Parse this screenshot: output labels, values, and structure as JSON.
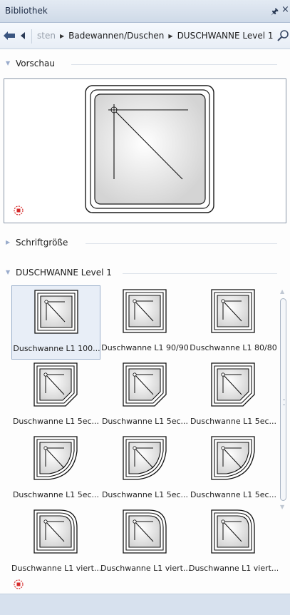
{
  "window": {
    "title": "Bibliothek",
    "pin_glyph": "p",
    "close_glyph": "×"
  },
  "nav": {
    "back_icon": "back-arrow-icon",
    "crumbs": [
      {
        "label": "sten"
      },
      {
        "label": "Badewannen/Duschen"
      },
      {
        "label": "DUSCHWANNE Level 1"
      }
    ],
    "search_icon": "search-icon"
  },
  "sections": {
    "preview": {
      "label": "Vorschau"
    },
    "font_size": {
      "label": "Schriftgröße"
    },
    "folder": {
      "label": "DUSCHWANNE Level 1"
    }
  },
  "items": [
    {
      "label": "Duschwanne L1 100...",
      "shape": "square",
      "selected": true
    },
    {
      "label": "Duschwanne L1 90/90",
      "shape": "square",
      "selected": false
    },
    {
      "label": "Duschwanne L1 80/80",
      "shape": "square",
      "selected": false
    },
    {
      "label": "Duschwanne L1 5ec...",
      "shape": "pentagon",
      "selected": false
    },
    {
      "label": "Duschwanne L1 5ec...",
      "shape": "pentagon",
      "selected": false
    },
    {
      "label": "Duschwanne L1 5ec...",
      "shape": "pentagon",
      "selected": false
    },
    {
      "label": "Duschwanne L1 5ec...",
      "shape": "quarter",
      "selected": false
    },
    {
      "label": "Duschwanne L1 5ec...",
      "shape": "quarter",
      "selected": false
    },
    {
      "label": "Duschwanne L1 5ec...",
      "shape": "quarter",
      "selected": false
    },
    {
      "label": "Duschwanne L1 viert...",
      "shape": "quarter-round",
      "selected": false
    },
    {
      "label": "Duschwanne L1 viert...",
      "shape": "quarter-round",
      "selected": false
    },
    {
      "label": "Duschwanne L1 viert...",
      "shape": "quarter-round",
      "selected": false
    }
  ],
  "colors": {
    "accent": "#cfdae8",
    "marker": "#d62a2a"
  }
}
